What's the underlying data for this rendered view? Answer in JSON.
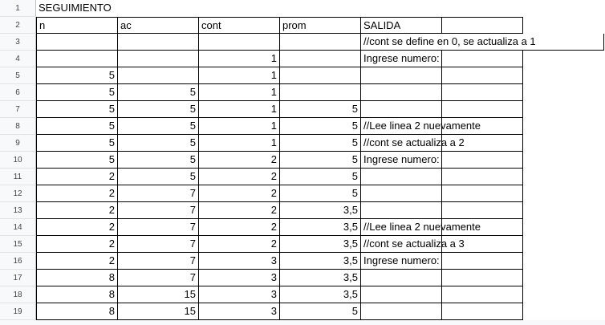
{
  "sheet": {
    "row_numbers": [
      "1",
      "2",
      "3",
      "4",
      "5",
      "6",
      "7",
      "8",
      "9",
      "10",
      "11",
      "12",
      "13",
      "14",
      "15",
      "16",
      "17",
      "18",
      "19"
    ],
    "title": "SEGUIMIENTO",
    "headers": {
      "n": "n",
      "ac": "ac",
      "cont": "cont",
      "prom": "prom",
      "salida": "SALIDA"
    },
    "rows": [
      {
        "n": "",
        "ac": "",
        "cont": "",
        "prom": "",
        "salida": "//cont se define en 0, se actualiza a 1"
      },
      {
        "n": "",
        "ac": "",
        "cont": "1",
        "prom": "",
        "salida": "Ingrese numero:"
      },
      {
        "n": "5",
        "ac": "",
        "cont": "1",
        "prom": "",
        "salida": ""
      },
      {
        "n": "5",
        "ac": "5",
        "cont": "1",
        "prom": "",
        "salida": ""
      },
      {
        "n": "5",
        "ac": "5",
        "cont": "1",
        "prom": "5",
        "salida": ""
      },
      {
        "n": "5",
        "ac": "5",
        "cont": "1",
        "prom": "5",
        "salida": "//Lee linea 2 nuevamente"
      },
      {
        "n": "5",
        "ac": "5",
        "cont": "1",
        "prom": "5",
        "salida": "//cont se actualiza a 2"
      },
      {
        "n": "5",
        "ac": "5",
        "cont": "2",
        "prom": "5",
        "salida": "Ingrese numero:"
      },
      {
        "n": "2",
        "ac": "5",
        "cont": "2",
        "prom": "5",
        "salida": ""
      },
      {
        "n": "2",
        "ac": "7",
        "cont": "2",
        "prom": "5",
        "salida": ""
      },
      {
        "n": "2",
        "ac": "7",
        "cont": "2",
        "prom": "3,5",
        "salida": ""
      },
      {
        "n": "2",
        "ac": "7",
        "cont": "2",
        "prom": "3,5",
        "salida": "//Lee linea 2 nuevamente"
      },
      {
        "n": "2",
        "ac": "7",
        "cont": "2",
        "prom": "3,5",
        "salida": "//cont se actualiza a 3"
      },
      {
        "n": "2",
        "ac": "7",
        "cont": "3",
        "prom": "3,5",
        "salida": "Ingrese numero:"
      },
      {
        "n": "8",
        "ac": "7",
        "cont": "3",
        "prom": "3,5",
        "salida": ""
      },
      {
        "n": "8",
        "ac": "15",
        "cont": "3",
        "prom": "3,5",
        "salida": ""
      },
      {
        "n": "8",
        "ac": "15",
        "cont": "3",
        "prom": "5",
        "salida": ""
      }
    ]
  }
}
